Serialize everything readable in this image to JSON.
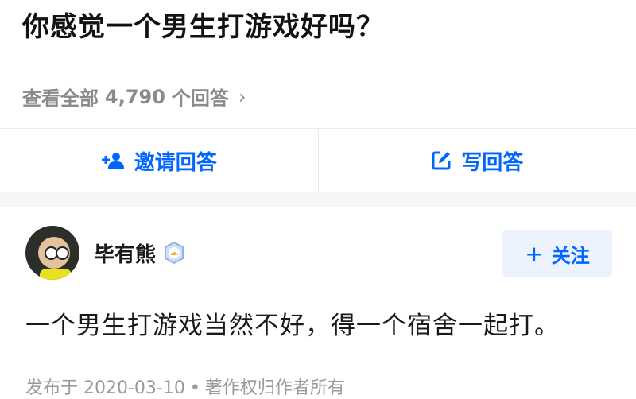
{
  "question": {
    "title": "你感觉一个男生打游戏好吗？",
    "view_all_prefix": "查看全部",
    "answer_count": "4,790",
    "view_all_suffix": "个回答",
    "chevron": "›"
  },
  "actions": {
    "invite_label": "邀请回答",
    "invite_icon": "add-person-icon",
    "write_label": "写回答",
    "write_icon": "edit-icon",
    "accent_color": "#0066ff"
  },
  "answer": {
    "author": "毕有熊",
    "badge_icon": "verified-badge-icon",
    "follow_label": "关注",
    "content": "一个男生打游戏当然不好，得一个宿舍一起打。",
    "published": "发布于 2020-03-10",
    "copyright": "著作权归作者所有",
    "separator": "•"
  }
}
